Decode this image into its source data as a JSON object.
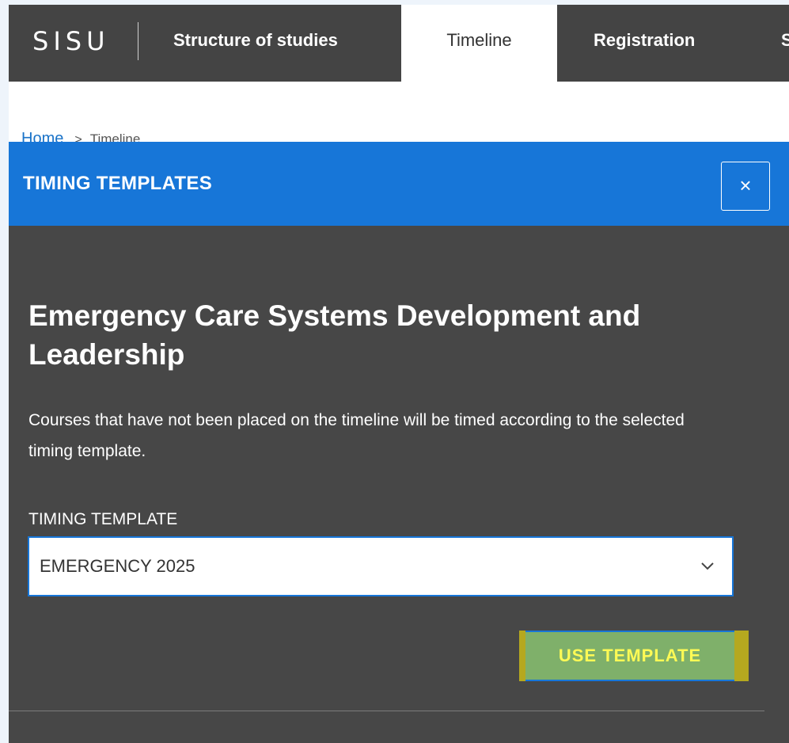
{
  "nav": {
    "logo": "SISU",
    "tabs": [
      {
        "label": "Structure of studies",
        "active": false
      },
      {
        "label": "Timeline",
        "active": true
      },
      {
        "label": "Registration",
        "active": false
      },
      {
        "label": "S",
        "active": false
      }
    ]
  },
  "breadcrumb": {
    "home": "Home",
    "current": "Timeline"
  },
  "modal": {
    "title": "TIMING TEMPLATES",
    "close_symbol": "×",
    "heading": "Emergency Care Systems Development and Leadership",
    "description": "Courses that have not been placed on the timeline will be timed according to the selected timing template.",
    "field_label": "TIMING TEMPLATE",
    "selected_template": "EMERGENCY 2025",
    "use_button_label": "USE TEMPLATE"
  },
  "colors": {
    "nav_background": "#444444",
    "modal_header": "#1776d8",
    "modal_background": "#474747",
    "button_background": "#7fb06a",
    "button_text": "#fffa55"
  },
  "icons": {
    "close": "close-icon",
    "select": "chevron-down-icon"
  }
}
